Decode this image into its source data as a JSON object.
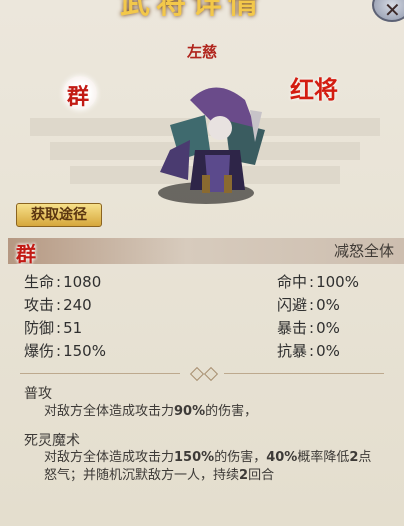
{
  "window": {
    "title": "武将详情",
    "close_icon": "close-icon"
  },
  "hero": {
    "name": "左慈",
    "faction_badge": "群",
    "rarity": "红将",
    "obtain_button": "获取途径"
  },
  "skill_header": {
    "faction_badge": "群",
    "title": "减怒全体"
  },
  "stats": {
    "left": [
      {
        "label": "生命",
        "value": "1080"
      },
      {
        "label": "攻击",
        "value": "240"
      },
      {
        "label": "防御",
        "value": "51"
      },
      {
        "label": "爆伤",
        "value": "150%"
      }
    ],
    "right": [
      {
        "label": "命中",
        "value": "100%"
      },
      {
        "label": "闪避",
        "value": "0%"
      },
      {
        "label": "暴击",
        "value": "0%"
      },
      {
        "label": "抗暴",
        "value": "0%"
      }
    ]
  },
  "skills": [
    {
      "name": "普攻",
      "desc_parts": [
        "对敌方全体造成攻击力",
        "90%",
        "的伤害，"
      ]
    },
    {
      "name": "死灵魔术",
      "desc_parts": [
        "对敌方全体造成攻击力",
        "150%",
        "的伤害，",
        "40%",
        "概率降低",
        "2",
        "点怒气；并随机沉默敌方一人，持续",
        "2",
        "回合"
      ]
    }
  ],
  "colors": {
    "accent_red": "#c21a14",
    "gold": "#f3c84a",
    "text": "#2f2f2f"
  }
}
